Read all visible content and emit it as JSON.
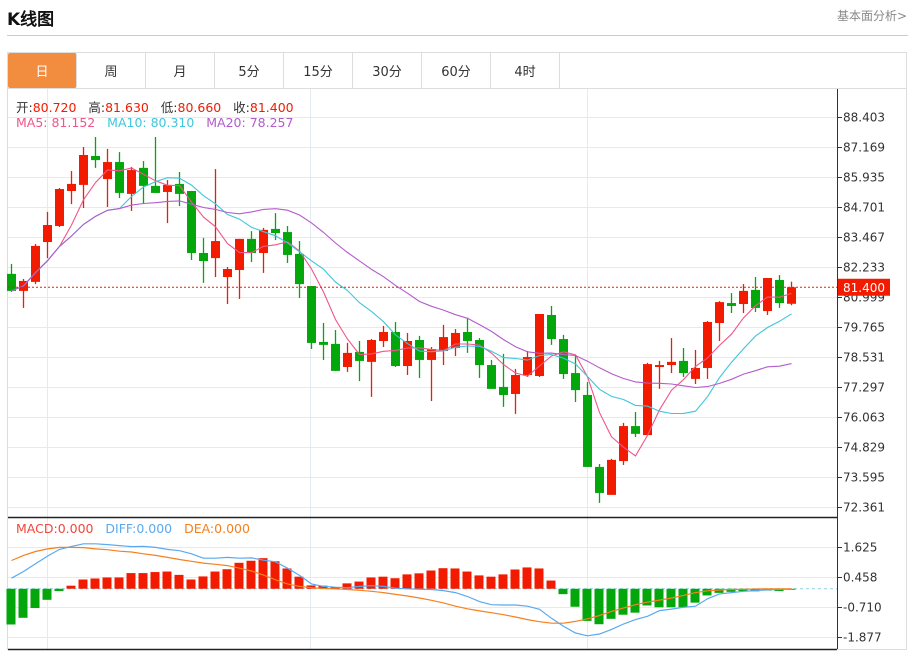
{
  "header": {
    "title": "K线图",
    "analysis_link": "基本面分析>"
  },
  "tabs": [
    {
      "label": "日",
      "active": true
    },
    {
      "label": "周"
    },
    {
      "label": "月"
    },
    {
      "label": "5分"
    },
    {
      "label": "15分"
    },
    {
      "label": "30分"
    },
    {
      "label": "60分"
    },
    {
      "label": "4时"
    }
  ],
  "ohlc_legend": {
    "open_label": "开:",
    "open": "80.720",
    "high_label": "高:",
    "high": "81.630",
    "low_label": "低:",
    "low": "80.660",
    "close_label": "收:",
    "close": "81.400"
  },
  "ma_legend": {
    "ma5_label": "MA5: ",
    "ma5": "81.152",
    "ma10_label": "MA10: ",
    "ma10": "80.310",
    "ma20_label": "MA20: ",
    "ma20": "78.257"
  },
  "macd_legend": {
    "macd_label": "MACD:",
    "macd": "0.000",
    "diff_label": "DIFF:",
    "diff": "0.000",
    "dea_label": "DEA:",
    "dea": "0.000"
  },
  "colors": {
    "up": "#f21b00",
    "down": "#03a60b",
    "ma5": "#f0568a",
    "ma10": "#3ec6dc",
    "ma20": "#b35ccc",
    "diff": "#5aa9f0",
    "dea": "#f5801f",
    "accent": "#f28c3f"
  },
  "chart_data": [
    {
      "type": "candlestick",
      "title": "K线图",
      "period": "日",
      "y_ticks": [
        "88.403",
        "87.169",
        "85.935",
        "84.701",
        "83.467",
        "82.233",
        "80.999",
        "79.765",
        "78.531",
        "77.297",
        "76.063",
        "74.829",
        "73.595",
        "72.361"
      ],
      "ylim": [
        72.361,
        88.403
      ],
      "current_price": "81.400",
      "candles_ohlc": [
        [
          81.95,
          82.36,
          81.21,
          81.25
        ],
        [
          81.25,
          81.74,
          80.55,
          81.66
        ],
        [
          81.62,
          83.18,
          81.53,
          83.1
        ],
        [
          83.26,
          84.5,
          82.6,
          83.96
        ],
        [
          83.92,
          85.48,
          83.88,
          85.44
        ],
        [
          85.36,
          86.18,
          84.82,
          85.65
        ],
        [
          85.61,
          87.17,
          84.66,
          86.84
        ],
        [
          86.8,
          87.58,
          86.31,
          86.63
        ],
        [
          85.85,
          87.09,
          84.7,
          86.55
        ],
        [
          86.55,
          86.96,
          85.07,
          85.28
        ],
        [
          85.24,
          86.35,
          84.54,
          86.22
        ],
        [
          86.31,
          86.59,
          84.82,
          85.57
        ],
        [
          85.57,
          87.58,
          85.28,
          85.28
        ],
        [
          85.32,
          85.81,
          84.04,
          85.61
        ],
        [
          85.65,
          86.14,
          84.74,
          85.24
        ],
        [
          85.36,
          85.36,
          82.52,
          82.81
        ],
        [
          82.81,
          83.43,
          81.58,
          82.48
        ],
        [
          82.6,
          86.26,
          81.82,
          83.3
        ],
        [
          81.82,
          82.23,
          80.71,
          82.15
        ],
        [
          82.11,
          83.39,
          80.92,
          83.39
        ],
        [
          83.39,
          83.71,
          82.44,
          82.81
        ],
        [
          82.81,
          83.84,
          81.99,
          83.76
        ],
        [
          83.8,
          84.45,
          83.34,
          83.63
        ],
        [
          83.67,
          83.92,
          82.4,
          82.73
        ],
        [
          82.77,
          83.3,
          80.96,
          81.53
        ],
        [
          81.45,
          81.45,
          78.86,
          79.11
        ],
        [
          79.15,
          79.93,
          78.41,
          79.03
        ],
        [
          79.07,
          79.64,
          77.96,
          77.96
        ],
        [
          78.12,
          79.11,
          77.92,
          78.7
        ],
        [
          78.74,
          79.19,
          77.54,
          78.37
        ],
        [
          78.33,
          79.27,
          76.89,
          79.23
        ],
        [
          79.19,
          79.81,
          78.94,
          79.56
        ],
        [
          79.56,
          79.97,
          78.12,
          78.16
        ],
        [
          78.16,
          79.52,
          77.79,
          79.19
        ],
        [
          79.23,
          79.4,
          77.67,
          78.41
        ],
        [
          78.41,
          78.94,
          76.72,
          78.86
        ],
        [
          78.78,
          79.85,
          78.2,
          79.35
        ],
        [
          78.9,
          79.68,
          78.57,
          79.52
        ],
        [
          79.56,
          80.14,
          78.7,
          79.19
        ],
        [
          79.23,
          79.31,
          77.67,
          78.2
        ],
        [
          78.2,
          78.41,
          77.22,
          77.22
        ],
        [
          77.3,
          78.66,
          76.48,
          76.97
        ],
        [
          77.01,
          78.04,
          76.19,
          77.79
        ],
        [
          77.79,
          78.78,
          77.71,
          78.53
        ],
        [
          77.75,
          80.3,
          77.71,
          80.3
        ],
        [
          80.26,
          80.63,
          79.03,
          79.27
        ],
        [
          79.27,
          79.44,
          77.63,
          77.83
        ],
        [
          77.87,
          78.57,
          76.68,
          77.17
        ],
        [
          76.97,
          77.5,
          74.01,
          74.01
        ],
        [
          74.01,
          74.13,
          72.53,
          72.94
        ],
        [
          72.86,
          74.34,
          72.86,
          74.3
        ],
        [
          74.25,
          75.82,
          74.09,
          75.69
        ],
        [
          75.69,
          76.27,
          75.24,
          75.37
        ],
        [
          75.32,
          78.29,
          75.32,
          78.24
        ],
        [
          78.12,
          78.37,
          77.22,
          78.2
        ],
        [
          78.2,
          79.31,
          77.87,
          78.33
        ],
        [
          78.37,
          78.9,
          77.71,
          77.87
        ],
        [
          77.63,
          78.82,
          77.42,
          78.08
        ],
        [
          78.08,
          80.01,
          77.63,
          79.97
        ],
        [
          79.93,
          80.83,
          79.19,
          80.79
        ],
        [
          80.75,
          81.16,
          80.34,
          80.63
        ],
        [
          80.71,
          81.53,
          80.34,
          81.25
        ],
        [
          81.29,
          81.82,
          80.38,
          80.55
        ],
        [
          80.42,
          81.78,
          80.26,
          81.78
        ],
        [
          81.7,
          81.9,
          80.55,
          80.75
        ],
        [
          80.72,
          81.63,
          80.66,
          81.4
        ]
      ],
      "moving_averages": [
        "MA5",
        "MA10",
        "MA20"
      ]
    },
    {
      "type": "bar+line",
      "title": "MACD",
      "y_ticks": [
        "1.625",
        "0.458",
        "-0.710",
        "-1.877"
      ],
      "ylim": [
        -2.2,
        1.9
      ],
      "macd_hist": [
        -1.39,
        -1.13,
        -0.75,
        -0.43,
        -0.09,
        0.12,
        0.36,
        0.4,
        0.44,
        0.44,
        0.61,
        0.61,
        0.65,
        0.67,
        0.54,
        0.36,
        0.48,
        0.67,
        0.76,
        1.01,
        1.09,
        1.19,
        1.07,
        0.79,
        0.47,
        0.13,
        0.12,
        0.06,
        0.21,
        0.28,
        0.44,
        0.47,
        0.41,
        0.56,
        0.6,
        0.71,
        0.8,
        0.79,
        0.67,
        0.52,
        0.47,
        0.56,
        0.75,
        0.83,
        0.79,
        0.32,
        -0.21,
        -0.7,
        -1.25,
        -1.38,
        -1.17,
        -1.01,
        -0.93,
        -0.65,
        -0.72,
        -0.72,
        -0.72,
        -0.54,
        -0.26,
        -0.16,
        -0.12,
        -0.09,
        -0.1,
        -0.07,
        -0.09,
        -0.03
      ],
      "diff": [
        0.41,
        0.67,
        0.97,
        1.27,
        1.53,
        1.65,
        1.75,
        1.75,
        1.72,
        1.68,
        1.64,
        1.65,
        1.61,
        1.53,
        1.48,
        1.36,
        1.19,
        1.19,
        1.22,
        1.19,
        1.2,
        1.11,
        1.05,
        0.8,
        0.52,
        0.19,
        0.09,
        0.06,
        0.04,
        0.09,
        0.12,
        0.09,
        0.02,
        0.0,
        -0.02,
        -0.03,
        -0.07,
        -0.15,
        -0.3,
        -0.5,
        -0.62,
        -0.63,
        -0.63,
        -0.68,
        -0.8,
        -1.15,
        -1.46,
        -1.72,
        -1.83,
        -1.76,
        -1.58,
        -1.37,
        -1.2,
        -1.07,
        -0.85,
        -0.79,
        -0.72,
        -0.68,
        -0.39,
        -0.2,
        -0.15,
        -0.1,
        -0.07,
        -0.04,
        -0.03,
        -0.01
      ],
      "dea": [
        1.1,
        1.3,
        1.45,
        1.55,
        1.61,
        1.61,
        1.6,
        1.55,
        1.52,
        1.46,
        1.43,
        1.36,
        1.3,
        1.22,
        1.14,
        1.07,
        1.0,
        0.95,
        0.9,
        0.8,
        0.69,
        0.53,
        0.35,
        0.19,
        0.09,
        0.04,
        0.01,
        0.0,
        -0.03,
        -0.06,
        -0.1,
        -0.15,
        -0.22,
        -0.28,
        -0.36,
        -0.45,
        -0.55,
        -0.68,
        -0.78,
        -0.86,
        -0.93,
        -1.01,
        -1.1,
        -1.2,
        -1.28,
        -1.34,
        -1.34,
        -1.27,
        -1.17,
        -1.04,
        -0.88,
        -0.75,
        -0.62,
        -0.52,
        -0.44,
        -0.36,
        -0.26,
        -0.15,
        -0.08,
        -0.05,
        -0.03,
        -0.02,
        -0.01,
        0.0,
        0.0,
        0.0
      ]
    }
  ]
}
